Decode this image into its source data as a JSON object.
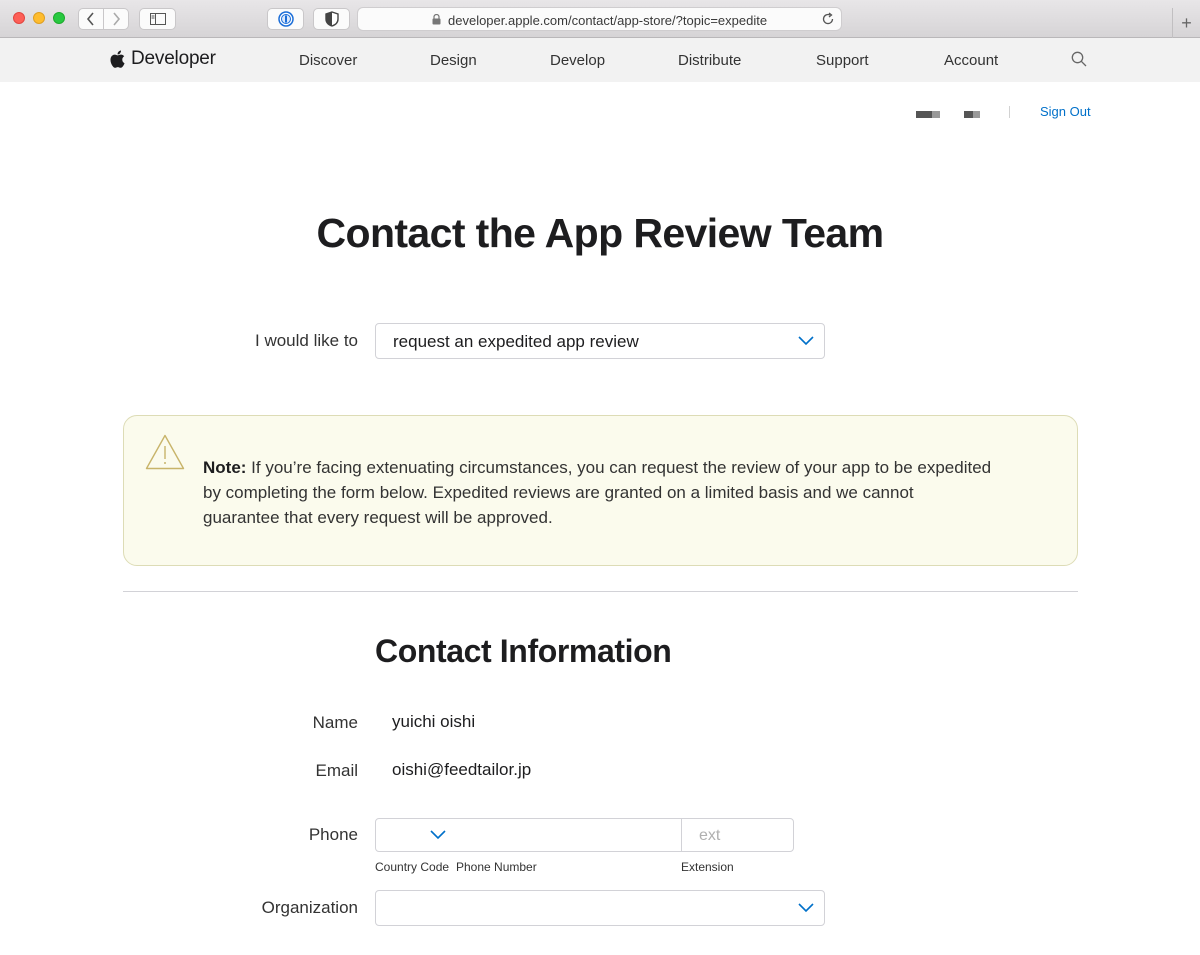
{
  "browser": {
    "url": "developer.apple.com/contact/app-store/?topic=expedite",
    "new_tab": "+"
  },
  "nav": {
    "logo_text": "Developer",
    "items": [
      "Discover",
      "Design",
      "Develop",
      "Distribute",
      "Support",
      "Account"
    ]
  },
  "user": {
    "sign_out": "Sign Out"
  },
  "page": {
    "title": "Contact the App Review Team",
    "request_label": "I would like to",
    "request_value": "request an expedited app review",
    "note_bold": "Note:",
    "note_text": " If you’re facing extenuating circumstances, you can request the review of your app to be expedited by completing the form below. Expedited reviews are granted on a limited basis and we cannot guarantee that every request will be approved.",
    "section_title": "Contact Information"
  },
  "form": {
    "name_label": "Name",
    "name_value": "yuichi oishi",
    "email_label": "Email",
    "email_value": "oishi@feedtailor.jp",
    "phone_label": "Phone",
    "ext_placeholder": "ext",
    "country_code_label": "Country Code",
    "phone_number_label": "Phone Number",
    "extension_label": "Extension",
    "organization_label": "Organization"
  },
  "colors": {
    "link": "#0070c9",
    "note_bg": "#fbfbed",
    "chevron": "#0070c9"
  }
}
